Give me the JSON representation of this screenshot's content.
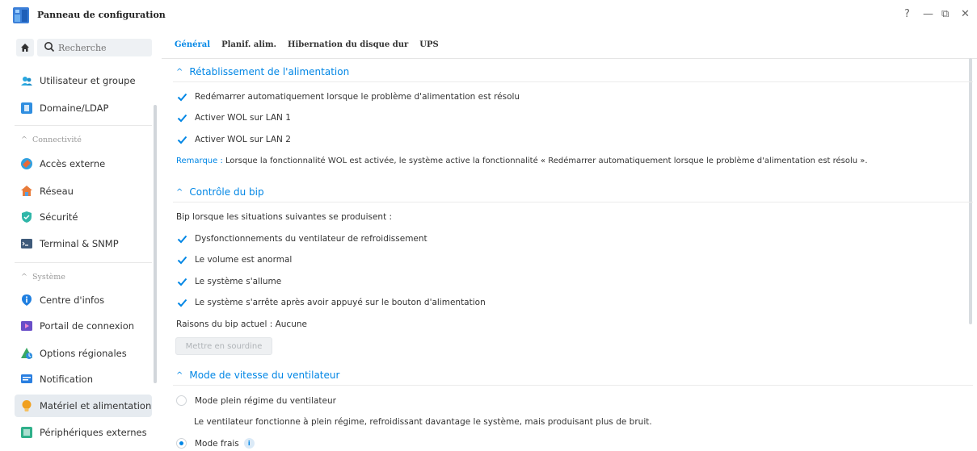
{
  "window": {
    "title": "Panneau de configuration",
    "controls": {
      "help": "?",
      "minimize": "—",
      "restore": "⧉",
      "close": "✕"
    }
  },
  "sidebar": {
    "search_placeholder": "Recherche",
    "sections": {
      "connectivity": "Connectivité",
      "system": "Système"
    },
    "items": [
      {
        "label": "Utilisateur et groupe",
        "icon": "users-icon",
        "color": "#2aa8e0"
      },
      {
        "label": "Domaine/LDAP",
        "icon": "domain-icon",
        "color": "#2f8ee0"
      },
      {
        "label": "Accès externe",
        "icon": "external-access-icon",
        "color": "#2fa0e0"
      },
      {
        "label": "Réseau",
        "icon": "network-icon",
        "color": "#e87b3a"
      },
      {
        "label": "Sécurité",
        "icon": "shield-icon",
        "color": "#2fb6a8"
      },
      {
        "label": "Terminal & SNMP",
        "icon": "terminal-icon",
        "color": "#3e5a7a"
      },
      {
        "label": "Centre d'infos",
        "icon": "info-icon",
        "color": "#1f7fe0"
      },
      {
        "label": "Portail de connexion",
        "icon": "portal-icon",
        "color": "#6a4fc8"
      },
      {
        "label": "Options régionales",
        "icon": "regional-icon",
        "color": "#3aa864"
      },
      {
        "label": "Notification",
        "icon": "notification-icon",
        "color": "#2a7fe0"
      },
      {
        "label": "Matériel et alimentation",
        "icon": "bulb-icon",
        "color": "#f0a020"
      },
      {
        "label": "Périphériques externes",
        "icon": "external-device-icon",
        "color": "#2fb08a"
      }
    ]
  },
  "tabs": [
    "Général",
    "Planif. alim.",
    "Hibernation du disque dur",
    "UPS"
  ],
  "power_recovery": {
    "title": "Rétablissement de l'alimentation",
    "options": [
      "Redémarrer automatiquement lorsque le problème d'alimentation est résolu",
      "Activer WOL sur LAN 1",
      "Activer WOL sur LAN 2"
    ],
    "note_label": "Remarque :",
    "note_text": "Lorsque la fonctionnalité WOL est activée, le système active la fonctionnalité « Redémarrer automatiquement lorsque le problème d'alimentation est résolu »."
  },
  "beep_control": {
    "title": "Contrôle du bip",
    "intro": "Bip lorsque les situations suivantes se produisent :",
    "options": [
      "Dysfonctionnements du ventilateur de refroidissement",
      "Le volume est anormal",
      "Le système s'allume",
      "Le système s'arrête après avoir appuyé sur le bouton d'alimentation"
    ],
    "current_reason": "Raisons du bip actuel : Aucune",
    "mute_button": "Mettre en sourdine"
  },
  "fan_speed": {
    "title": "Mode de vitesse du ventilateur",
    "full_mode": "Mode plein régime du ventilateur",
    "full_desc": "Le ventilateur fonctionne à plein régime, refroidissant davantage le système, mais produisant plus de bruit.",
    "cool_mode": "Mode frais",
    "info": "i"
  },
  "colors": {
    "accent": "#0086e5",
    "active_bg": "#e6ebf0"
  }
}
